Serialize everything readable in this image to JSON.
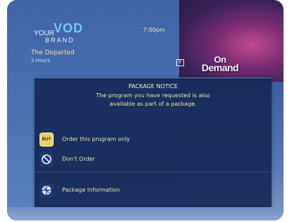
{
  "header": {
    "brand_prefix": "YOUR",
    "brand_main": "VOD",
    "brand_sub": "BRAND",
    "clock": "7:00pm"
  },
  "logo": {
    "line1": "On",
    "line2": "Demand"
  },
  "listing": {
    "title": "The Departed",
    "subtitle": "2 Hours",
    "rating": "R"
  },
  "dialog": {
    "title": "PACKAGE NOTICE",
    "message_line1": "The program you have requested is also",
    "message_line2": "available as part of a package.",
    "options": [
      {
        "icon": "buy-icon",
        "icon_text": "BUY",
        "label": "Order this program only"
      },
      {
        "icon": "no-sign-icon",
        "label": "Don't Order"
      },
      {
        "icon": "package-icon",
        "label": "Package Information"
      }
    ]
  },
  "colors": {
    "dialog_bg": "#142a58",
    "text_accent": "#f0e4a6",
    "buy_button": "#e8cf6a"
  }
}
